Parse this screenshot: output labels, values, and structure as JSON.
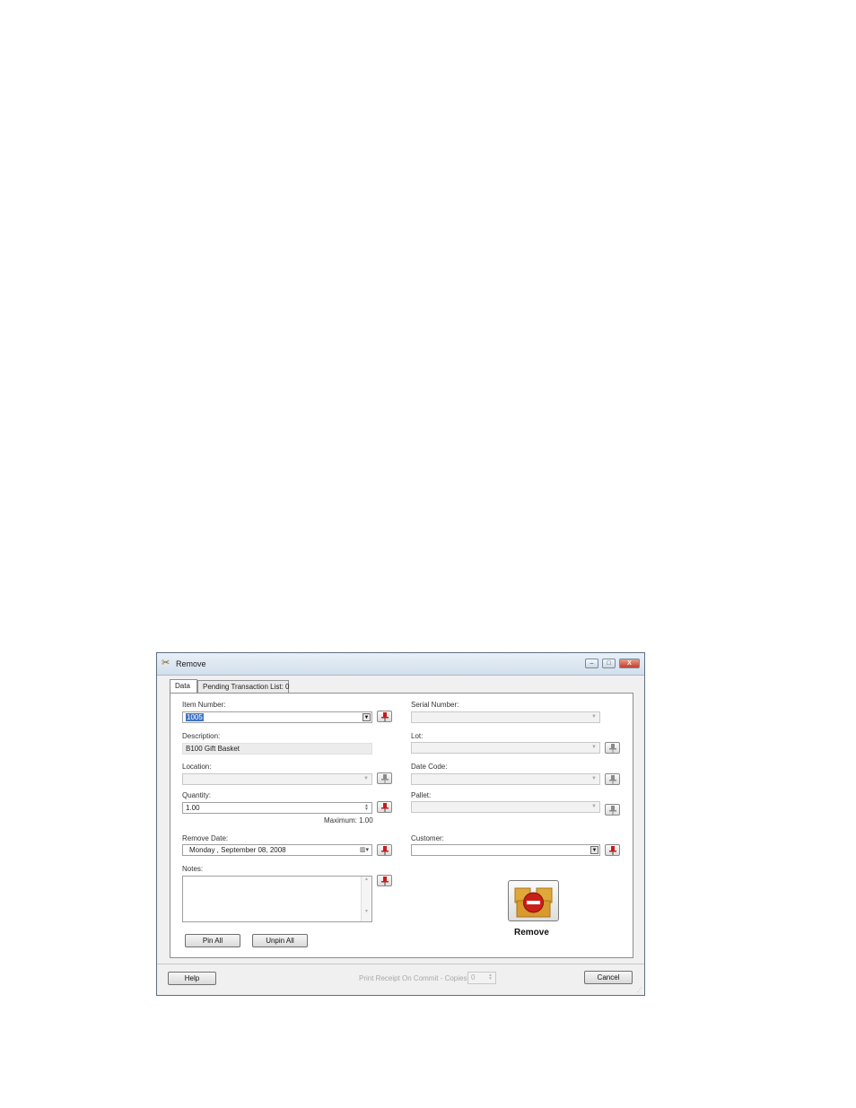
{
  "window": {
    "title": "Remove",
    "minimize": "–",
    "maximize": "□",
    "close": "X"
  },
  "tabs": [
    {
      "label": "Data"
    },
    {
      "label": "Pending Transaction List: 0"
    }
  ],
  "fields": {
    "item_number": {
      "label": "Item Number:",
      "value": "1005"
    },
    "description": {
      "label": "Description:",
      "value": "B100 Gift Basket"
    },
    "location": {
      "label": "Location:",
      "value": ""
    },
    "quantity": {
      "label": "Quantity:",
      "value": "1.00",
      "maximum": "Maximum: 1.00"
    },
    "remove_date": {
      "label": "Remove Date:",
      "value": "Monday    , September 08, 2008"
    },
    "notes": {
      "label": "Notes:",
      "value": ""
    },
    "serial_number": {
      "label": "Serial Number:",
      "value": ""
    },
    "lot": {
      "label": "Lot:",
      "value": ""
    },
    "date_code": {
      "label": "Date Code:",
      "value": ""
    },
    "pallet": {
      "label": "Pallet:",
      "value": ""
    },
    "customer": {
      "label": "Customer:",
      "value": ""
    }
  },
  "buttons": {
    "pin_all": "Pin All",
    "unpin_all": "Unpin All",
    "remove": "Remove",
    "help": "Help",
    "cancel": "Cancel"
  },
  "print_receipt": {
    "label": "Print Receipt On Commit - Copies:",
    "copies": "0"
  },
  "colors": {
    "pin_active": "#cc1a1a",
    "pin_inactive": "#7a7a7a",
    "selection": "#3f74c6"
  }
}
